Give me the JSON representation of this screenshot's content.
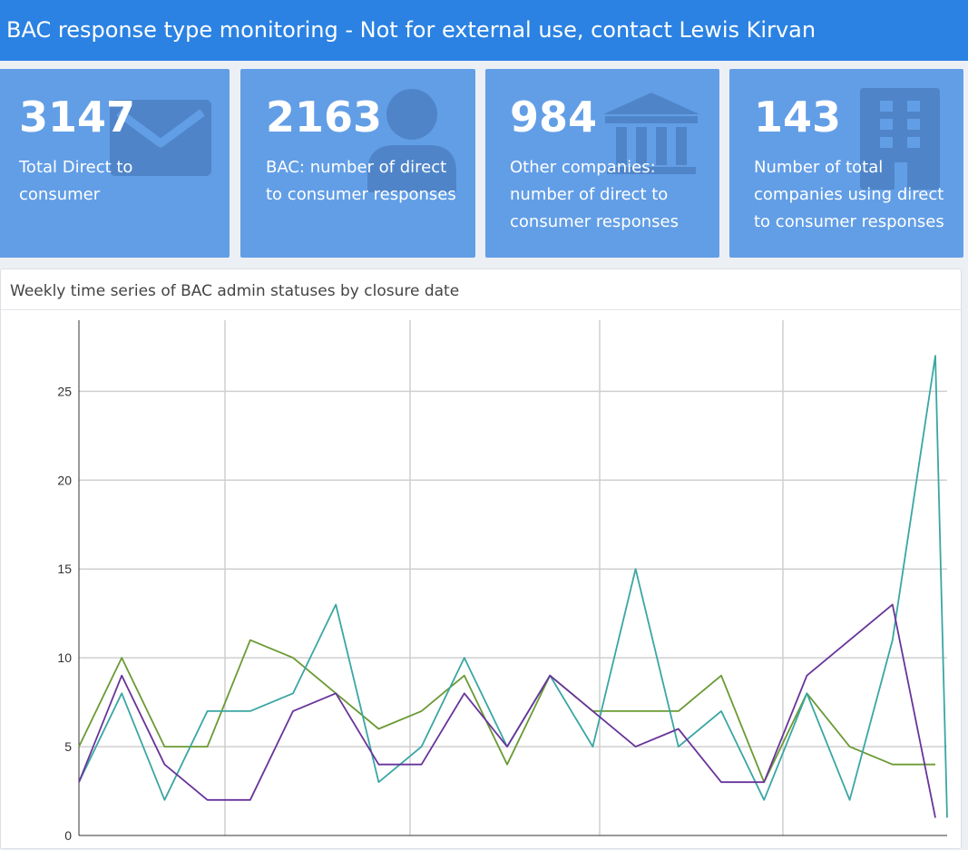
{
  "header": {
    "title": "BAC response type monitoring - Not for external use, contact Lewis Kirvan"
  },
  "boxes": [
    {
      "value": "3147",
      "label": "Total Direct to consumer",
      "icon": "envelope-icon"
    },
    {
      "value": "2163",
      "label": "BAC: number of direct to consumer responses",
      "icon": "user-icon"
    },
    {
      "value": "984",
      "label": "Other companies: number of direct to consumer responses",
      "icon": "bank-icon"
    },
    {
      "value": "143",
      "label": "Number of total companies using direct to consumer responses",
      "icon": "building-icon"
    }
  ],
  "colors": {
    "header": "#2b82e2",
    "box": "#629ee6"
  },
  "panel": {
    "title": "Weekly time series of BAC admin statuses by closure date"
  },
  "chart_data": {
    "type": "line",
    "title": "",
    "xlabel": "",
    "ylabel": "",
    "ylim": [
      0,
      29
    ],
    "yticks": [
      0,
      5,
      10,
      15,
      20,
      25
    ],
    "grid": true,
    "legend": "none",
    "series": [
      {
        "color": "#6a9a34",
        "values": [
          5,
          10,
          5,
          5,
          11,
          10,
          8,
          6,
          7,
          9,
          4,
          9,
          7,
          7,
          7,
          9,
          3,
          8,
          5,
          4,
          4
        ]
      },
      {
        "color": "#3aa6a3",
        "values": [
          3,
          8,
          2,
          7,
          7,
          8,
          13,
          3,
          5,
          10,
          5,
          9,
          5,
          15,
          5,
          7,
          2,
          8,
          2,
          11,
          27,
          1
        ]
      },
      {
        "color": "#68349a",
        "values": [
          3,
          9,
          4,
          2,
          2,
          7,
          8,
          4,
          4,
          8,
          5,
          9,
          7,
          5,
          6,
          3,
          3,
          9,
          11,
          13,
          1
        ]
      }
    ]
  }
}
